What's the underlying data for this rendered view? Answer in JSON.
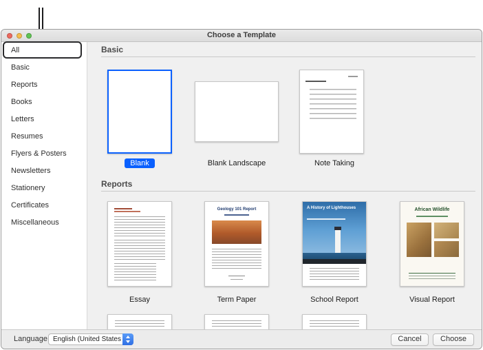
{
  "window": {
    "title": "Choose a Template"
  },
  "sidebar": {
    "selected": "All",
    "items": [
      {
        "label": "All"
      },
      {
        "label": "Basic"
      },
      {
        "label": "Reports"
      },
      {
        "label": "Books"
      },
      {
        "label": "Letters"
      },
      {
        "label": "Resumes"
      },
      {
        "label": "Flyers & Posters"
      },
      {
        "label": "Newsletters"
      },
      {
        "label": "Stationery"
      },
      {
        "label": "Certificates"
      },
      {
        "label": "Miscellaneous"
      }
    ]
  },
  "sections": [
    {
      "title": "Basic",
      "templates": [
        {
          "name": "Blank",
          "selected": true
        },
        {
          "name": "Blank Landscape"
        },
        {
          "name": "Note Taking"
        }
      ]
    },
    {
      "title": "Reports",
      "templates": [
        {
          "name": "Essay"
        },
        {
          "name": "Term Paper",
          "thumbnail_title": "Geology 101 Report"
        },
        {
          "name": "School Report",
          "thumbnail_title": "A History of Lighthouses"
        },
        {
          "name": "Visual Report",
          "thumbnail_title": "African Wildlife"
        }
      ]
    }
  ],
  "footer": {
    "language_label": "Language:",
    "language_value": "English (United States)",
    "cancel_label": "Cancel",
    "choose_label": "Choose"
  },
  "colors": {
    "selection_blue": "#0a60fe",
    "stepper_blue": "#3478f6",
    "callout": "#2a2a2c"
  }
}
